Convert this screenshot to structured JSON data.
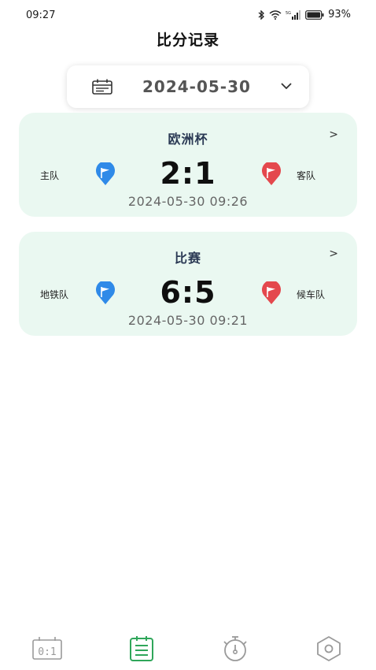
{
  "status_bar": {
    "time": "09:27",
    "battery_percent": "93%",
    "icons": [
      "bluetooth-icon",
      "wifi-icon",
      "signal-icon",
      "battery-icon"
    ]
  },
  "header": {
    "title": "比分记录"
  },
  "date_picker": {
    "date": "2024-05-30",
    "icon": "calendar-icon",
    "dropdown_icon": "chevron-down-icon"
  },
  "matches": [
    {
      "title": "欧洲杯",
      "home_team": "主队",
      "away_team": "客队",
      "score": "2:1",
      "time": "2024-05-30 09:26",
      "arrow": ">"
    },
    {
      "title": "比赛",
      "home_team": "地铁队",
      "away_team": "候车队",
      "score": "6:5",
      "time": "2024-05-30 09:21",
      "arrow": ">"
    }
  ],
  "bottom_nav": {
    "items": [
      {
        "name": "scoreboard",
        "icon": "scoreboard-icon",
        "text": "0:1",
        "active": false
      },
      {
        "name": "records",
        "icon": "records-icon",
        "active": true
      },
      {
        "name": "timer",
        "icon": "stopwatch-icon",
        "active": false
      },
      {
        "name": "settings",
        "icon": "settings-hexagon-icon",
        "active": false
      }
    ]
  },
  "colors": {
    "card_background": "#eaf8f1",
    "home_flag": "#2f8ae8",
    "away_flag": "#e4484d",
    "active_nav": "#2fa65a",
    "inactive_nav": "#9a9a9a"
  }
}
